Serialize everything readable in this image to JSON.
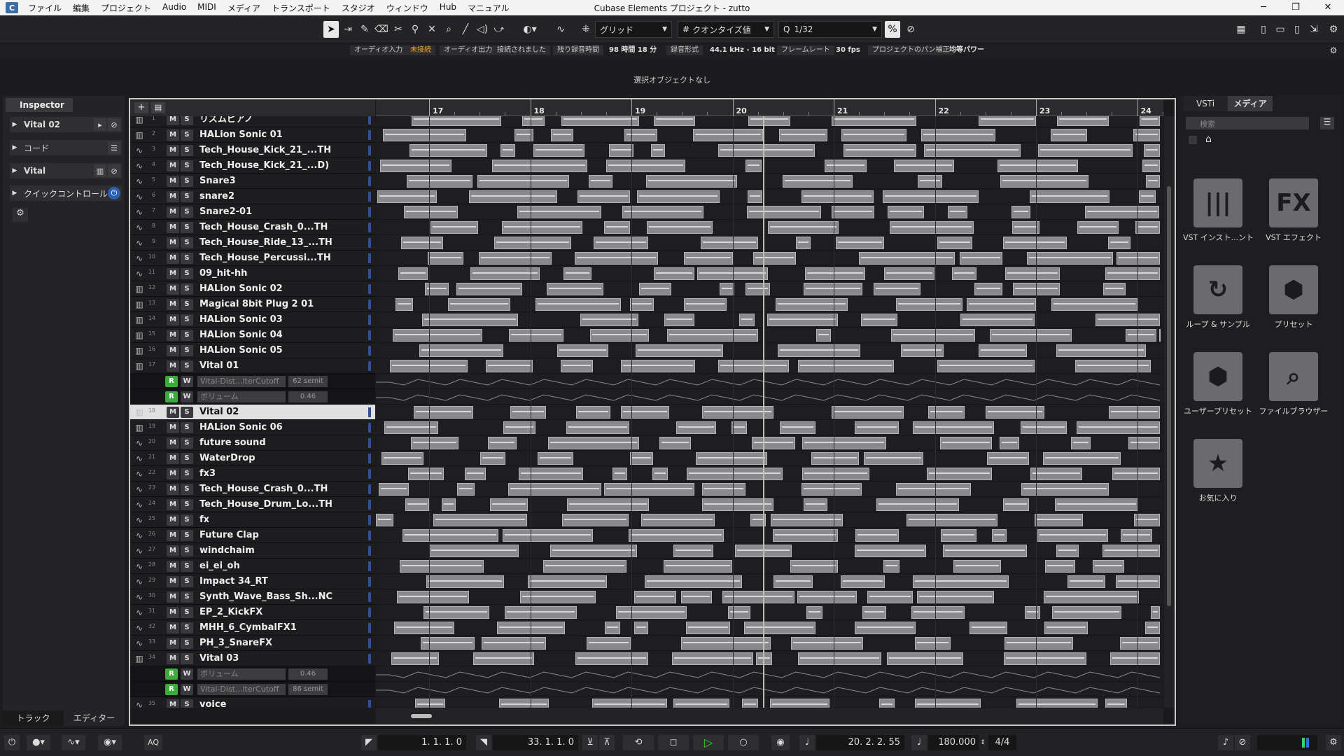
{
  "window": {
    "title": "Cubase Elements プロジェクト - zutto",
    "controls": [
      "─",
      "❐",
      "✕"
    ]
  },
  "menu": [
    "ファイル",
    "編集",
    "プロジェクト",
    "Audio",
    "MIDI",
    "メディア",
    "トランスポート",
    "スタジオ",
    "ウィンドウ",
    "Hub",
    "マニュアル"
  ],
  "toolbar": {
    "snap_mode": "グリッド",
    "quantize_mode": "クオンタイズ値",
    "quantize_value": "1/32"
  },
  "status": {
    "audio_in_label": "オーディオ入力",
    "audio_in_value": "未接続",
    "audio_out_label": "オーディオ出力",
    "audio_out_value": "接続されました",
    "rec_time_label": "残り録音時間",
    "rec_time_value": "98 時間 18 分",
    "rec_format_label": "録音形式",
    "rec_format_value": "44.1 kHz - 16 bit",
    "frame_rate_label": "フレームレート",
    "frame_rate_value": "30 fps",
    "pan_label": "プロジェクトのパン補正",
    "pan_value": "均等パワー"
  },
  "info_line": "選択オブジェクトなし",
  "inspector": {
    "tab": "Inspector",
    "sections": [
      {
        "label": "Vital 02"
      },
      {
        "label": "コード"
      },
      {
        "label": "Vital"
      },
      {
        "label": "クイックコントロール"
      }
    ],
    "bottom_tabs": [
      "トラック",
      "エディター"
    ]
  },
  "ruler": {
    "bars": [
      "17",
      "18",
      "19",
      "20",
      "21",
      "22",
      "23",
      "24"
    ]
  },
  "track_rows": [
    {
      "kind": "track",
      "num": "1",
      "name": "リズムピアノ",
      "icon": "instrument"
    },
    {
      "kind": "track",
      "num": "2",
      "name": "HALion Sonic 01",
      "icon": "instrument"
    },
    {
      "kind": "track",
      "num": "3",
      "name": "Tech_House_Kick_21_...TH",
      "icon": "audio"
    },
    {
      "kind": "track",
      "num": "4",
      "name": "Tech_House_Kick_21_...D)",
      "icon": "audio"
    },
    {
      "kind": "track",
      "num": "5",
      "name": "Snare3",
      "icon": "audio"
    },
    {
      "kind": "track",
      "num": "6",
      "name": "snare2",
      "icon": "audio"
    },
    {
      "kind": "track",
      "num": "7",
      "name": "Snare2-01",
      "icon": "audio"
    },
    {
      "kind": "track",
      "num": "8",
      "name": "Tech_House_Crash_0...TH",
      "icon": "audio"
    },
    {
      "kind": "track",
      "num": "9",
      "name": "Tech_House_Ride_13_...TH",
      "icon": "audio"
    },
    {
      "kind": "track",
      "num": "10",
      "name": "Tech_House_Percussi...TH",
      "icon": "audio"
    },
    {
      "kind": "track",
      "num": "11",
      "name": "09_hit-hh",
      "icon": "audio"
    },
    {
      "kind": "track",
      "num": "12",
      "name": "HALion Sonic 02",
      "icon": "instrument"
    },
    {
      "kind": "track",
      "num": "13",
      "name": "Magical 8bit Plug 2 01",
      "icon": "instrument"
    },
    {
      "kind": "track",
      "num": "14",
      "name": "HALion Sonic 03",
      "icon": "instrument"
    },
    {
      "kind": "track",
      "num": "15",
      "name": "HALion Sonic 04",
      "icon": "instrument"
    },
    {
      "kind": "track",
      "num": "16",
      "name": "HALion Sonic 05",
      "icon": "instrument"
    },
    {
      "kind": "track",
      "num": "17",
      "name": "Vital 01",
      "icon": "instrument"
    },
    {
      "kind": "lane",
      "param": "Vital-Dist...lterCutoff",
      "value": "62 semit"
    },
    {
      "kind": "lane",
      "param": "ボリューム",
      "value": "0.46"
    },
    {
      "kind": "track",
      "num": "18",
      "name": "Vital 02",
      "icon": "instrument",
      "selected": true
    },
    {
      "kind": "track",
      "num": "19",
      "name": "HALion Sonic 06",
      "icon": "instrument"
    },
    {
      "kind": "track",
      "num": "20",
      "name": "future sound",
      "icon": "audio"
    },
    {
      "kind": "track",
      "num": "21",
      "name": "WaterDrop",
      "icon": "audio"
    },
    {
      "kind": "track",
      "num": "22",
      "name": "fx3",
      "icon": "audio"
    },
    {
      "kind": "track",
      "num": "23",
      "name": "Tech_House_Crash_0...TH",
      "icon": "audio"
    },
    {
      "kind": "track",
      "num": "24",
      "name": "Tech_House_Drum_Lo...TH",
      "icon": "audio"
    },
    {
      "kind": "track",
      "num": "25",
      "name": "fx",
      "icon": "audio"
    },
    {
      "kind": "track",
      "num": "26",
      "name": "Future Clap",
      "icon": "audio"
    },
    {
      "kind": "track",
      "num": "27",
      "name": "windchaim",
      "icon": "audio"
    },
    {
      "kind": "track",
      "num": "28",
      "name": "ei_ei_oh",
      "icon": "audio"
    },
    {
      "kind": "track",
      "num": "29",
      "name": "Impact 34_RT",
      "icon": "audio"
    },
    {
      "kind": "track",
      "num": "30",
      "name": "Synth_Wave_Bass_Sh...NC",
      "icon": "audio"
    },
    {
      "kind": "track",
      "num": "31",
      "name": "EP_2_KickFX",
      "icon": "audio"
    },
    {
      "kind": "track",
      "num": "32",
      "name": "MHH_6_CymbalFX1",
      "icon": "audio"
    },
    {
      "kind": "track",
      "num": "33",
      "name": "PH_3_SnareFX",
      "icon": "audio"
    },
    {
      "kind": "track",
      "num": "34",
      "name": "Vital 03",
      "icon": "instrument"
    },
    {
      "kind": "lane",
      "param": "ボリューム",
      "value": "0.46"
    },
    {
      "kind": "lane",
      "param": "Vital-Dist...lterCutoff",
      "value": "86 semit"
    },
    {
      "kind": "track",
      "num": "35",
      "name": "voice",
      "icon": "audio"
    }
  ],
  "button_labels": {
    "mute": "M",
    "solo": "S",
    "read": "R",
    "write": "W"
  },
  "media": {
    "tabs": [
      "VSTi",
      "メディア"
    ],
    "active_tab": "メディア",
    "search_placeholder": "検索",
    "tiles": [
      {
        "label": "VST インスト...ント",
        "icon": "piano-keys-icon",
        "glyph": "|||"
      },
      {
        "label": "VST エフェクト",
        "icon": "fx-icon",
        "glyph": "FX"
      },
      {
        "label": "ループ & サンプル",
        "icon": "loop-icon",
        "glyph": "↻"
      },
      {
        "label": "プリセット",
        "icon": "hexagon-icon",
        "glyph": "⬢"
      },
      {
        "label": "ユーザープリセット",
        "icon": "user-preset-icon",
        "glyph": "⬢"
      },
      {
        "label": "ファイルブラウザー",
        "icon": "file-browser-icon",
        "glyph": "⌕"
      },
      {
        "label": "お気に入り",
        "icon": "star-icon",
        "glyph": "★"
      }
    ]
  },
  "transport": {
    "left_locator": "1. 1. 1.   0",
    "right_locator": "33. 1. 1.   0",
    "position": "20. 2. 2. 55",
    "tempo": "180.000",
    "signature": "4/4",
    "aq": "AQ"
  },
  "colors": {
    "event": "#8a8a8d",
    "rec_green": "#3bab3b",
    "play_green": "#35d035",
    "warn_orange": "#f0a030"
  }
}
